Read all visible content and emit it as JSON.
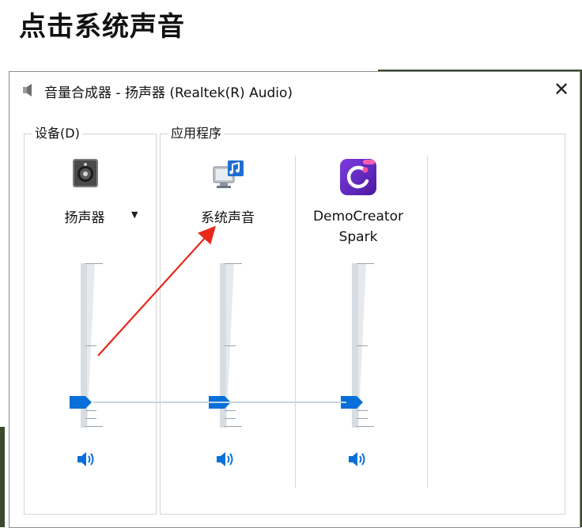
{
  "heading": "点击系统声音",
  "window": {
    "title": "音量合成器 - 扬声器 (Realtek(R) Audio)",
    "close_glyph": "✕"
  },
  "device_group": {
    "legend": "设备(D)",
    "device": {
      "icon": "speaker-device-icon",
      "label": "扬声器",
      "volume_percent": 12
    }
  },
  "apps_group": {
    "legend": "应用程序",
    "apps": [
      {
        "icon": "system-sounds-icon",
        "label": "系统声音",
        "volume_percent": 12
      },
      {
        "icon": "democreator-app-icon",
        "label": "DemoCreator Spark",
        "volume_percent": 12
      }
    ]
  },
  "colors": {
    "accent": "#0a6fd8",
    "annotation_arrow": "#e8271b",
    "track": "#d8dde2",
    "app_icon_purple": "#6a2cc8"
  }
}
